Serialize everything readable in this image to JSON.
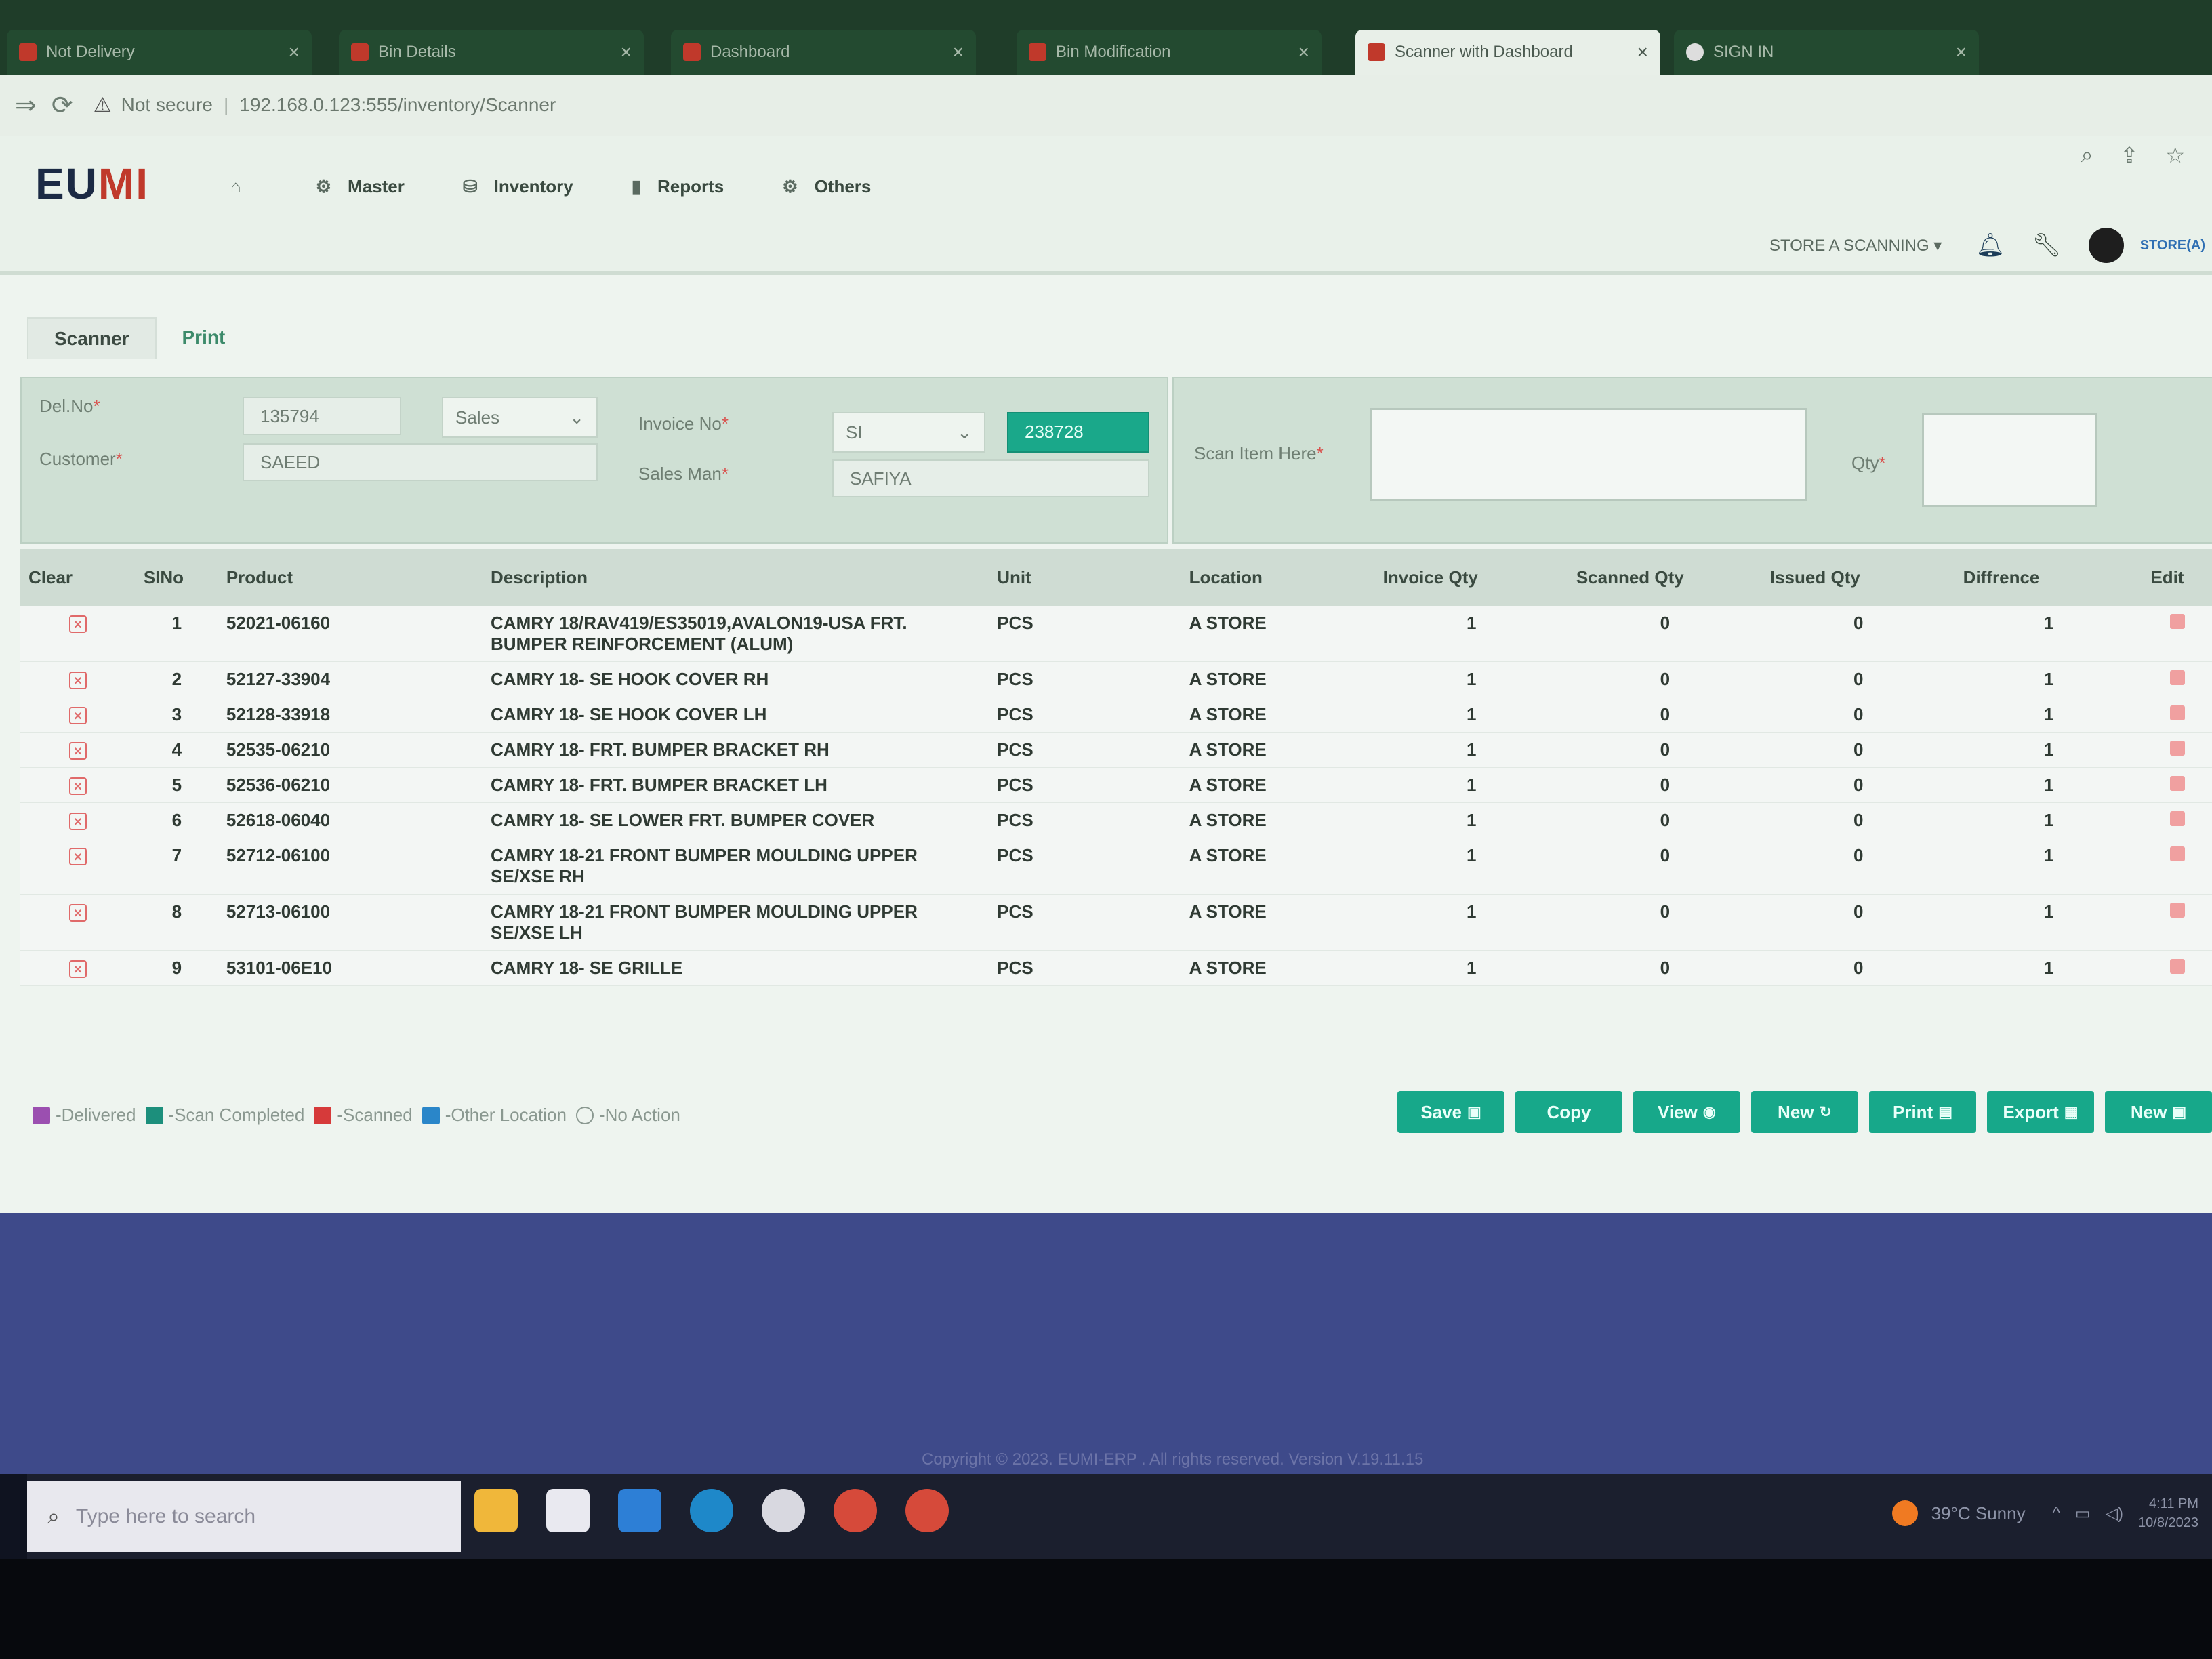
{
  "browser": {
    "tabs": [
      {
        "label": "Not Delivery",
        "active": false
      },
      {
        "label": "Bin Details",
        "active": false
      },
      {
        "label": "Dashboard",
        "active": false
      },
      {
        "label": "Bin Modification",
        "active": false
      },
      {
        "label": "Scanner with Dashboard",
        "active": true
      },
      {
        "label": "SIGN IN",
        "active": false
      }
    ],
    "security_label": "Not secure",
    "url": "192.168.0.123:555/inventory/Scanner"
  },
  "app": {
    "logo_part1": "EU",
    "logo_part2": "MI",
    "menu": [
      {
        "icon": "⌂",
        "label": ""
      },
      {
        "icon": "⚙",
        "label": "Master"
      },
      {
        "icon": "⛁",
        "label": "Inventory"
      },
      {
        "icon": "▮",
        "label": "Reports"
      },
      {
        "icon": "⚙",
        "label": "Others"
      }
    ],
    "store_select": "STORE A SCANNING",
    "store_label": "STORE(A)"
  },
  "subtabs": {
    "scanner": "Scanner",
    "print": "Print"
  },
  "form": {
    "del_no_label": "Del.No",
    "del_no_value": "135794",
    "type_select": "Sales",
    "customer_label": "Customer",
    "customer_value": "SAEED",
    "invoice_label": "Invoice No",
    "invoice_prefix": "SI",
    "invoice_value": "238728",
    "salesman_label": "Sales Man",
    "salesman_value": "SAFIYA",
    "scan_label": "Scan Item Here",
    "qty_label": "Qty",
    "required_mark": "*"
  },
  "table": {
    "headers": {
      "clear": "Clear",
      "slno": "SlNo",
      "product": "Product",
      "description": "Description",
      "unit": "Unit",
      "location": "Location",
      "invoice_qty": "Invoice Qty",
      "scanned_qty": "Scanned Qty",
      "issued_qty": "Issued Qty",
      "difference": "Diffrence",
      "edit": "Edit"
    },
    "rows": [
      {
        "slno": "1",
        "product": "52021-06160",
        "description": "CAMRY 18/RAV419/ES35019,AVALON19-USA FRT. BUMPER REINFORCEMENT (ALUM)",
        "unit": "PCS",
        "location": "A STORE",
        "invoice_qty": "1",
        "scanned_qty": "0",
        "issued_qty": "0",
        "difference": "1"
      },
      {
        "slno": "2",
        "product": "52127-33904",
        "description": "CAMRY 18- SE HOOK COVER RH",
        "unit": "PCS",
        "location": "A STORE",
        "invoice_qty": "1",
        "scanned_qty": "0",
        "issued_qty": "0",
        "difference": "1"
      },
      {
        "slno": "3",
        "product": "52128-33918",
        "description": "CAMRY 18- SE HOOK COVER LH",
        "unit": "PCS",
        "location": "A STORE",
        "invoice_qty": "1",
        "scanned_qty": "0",
        "issued_qty": "0",
        "difference": "1"
      },
      {
        "slno": "4",
        "product": "52535-06210",
        "description": "CAMRY 18- FRT. BUMPER BRACKET RH",
        "unit": "PCS",
        "location": "A STORE",
        "invoice_qty": "1",
        "scanned_qty": "0",
        "issued_qty": "0",
        "difference": "1"
      },
      {
        "slno": "5",
        "product": "52536-06210",
        "description": "CAMRY 18- FRT. BUMPER BRACKET LH",
        "unit": "PCS",
        "location": "A STORE",
        "invoice_qty": "1",
        "scanned_qty": "0",
        "issued_qty": "0",
        "difference": "1"
      },
      {
        "slno": "6",
        "product": "52618-06040",
        "description": "CAMRY 18- SE LOWER FRT. BUMPER COVER",
        "unit": "PCS",
        "location": "A STORE",
        "invoice_qty": "1",
        "scanned_qty": "0",
        "issued_qty": "0",
        "difference": "1"
      },
      {
        "slno": "7",
        "product": "52712-06100",
        "description": "CAMRY 18-21 FRONT BUMPER MOULDING UPPER SE/XSE RH",
        "unit": "PCS",
        "location": "A STORE",
        "invoice_qty": "1",
        "scanned_qty": "0",
        "issued_qty": "0",
        "difference": "1"
      },
      {
        "slno": "8",
        "product": "52713-06100",
        "description": "CAMRY 18-21 FRONT BUMPER MOULDING UPPER SE/XSE LH",
        "unit": "PCS",
        "location": "A STORE",
        "invoice_qty": "1",
        "scanned_qty": "0",
        "issued_qty": "0",
        "difference": "1"
      },
      {
        "slno": "9",
        "product": "53101-06E10",
        "description": "CAMRY 18- SE GRILLE",
        "unit": "PCS",
        "location": "A STORE",
        "invoice_qty": "1",
        "scanned_qty": "0",
        "issued_qty": "0",
        "difference": "1"
      }
    ]
  },
  "legend": [
    {
      "label": "-Delivered",
      "color": "#9b4fb0"
    },
    {
      "label": "-Scan Completed",
      "color": "#1c8f7c"
    },
    {
      "label": "-Scanned",
      "color": "#d63a3a"
    },
    {
      "label": "-Other Location",
      "color": "#2a86c9"
    },
    {
      "label": "-No Action",
      "color": "none"
    }
  ],
  "buttons": [
    {
      "label": "Save",
      "icon": "▣"
    },
    {
      "label": "Copy",
      "icon": ""
    },
    {
      "label": "View",
      "icon": "◉"
    },
    {
      "label": "New",
      "icon": "↻"
    },
    {
      "label": "Print",
      "icon": "▤"
    },
    {
      "label": "Export",
      "icon": "▦"
    },
    {
      "label": "New",
      "icon": "▣"
    }
  ],
  "footer": {
    "copyright": "Copyright © 2023. EUMI-ERP . All rights reserved. Version V.19.11.15"
  },
  "taskbar": {
    "search_placeholder": "Type here to search",
    "weather": "39°C  Sunny",
    "time": "4:11 PM",
    "date": "10/8/2023"
  },
  "colors": {
    "accent": "#17a88a",
    "clear_icon": "#e06a6a",
    "taskbar": "#1b1f2e"
  }
}
